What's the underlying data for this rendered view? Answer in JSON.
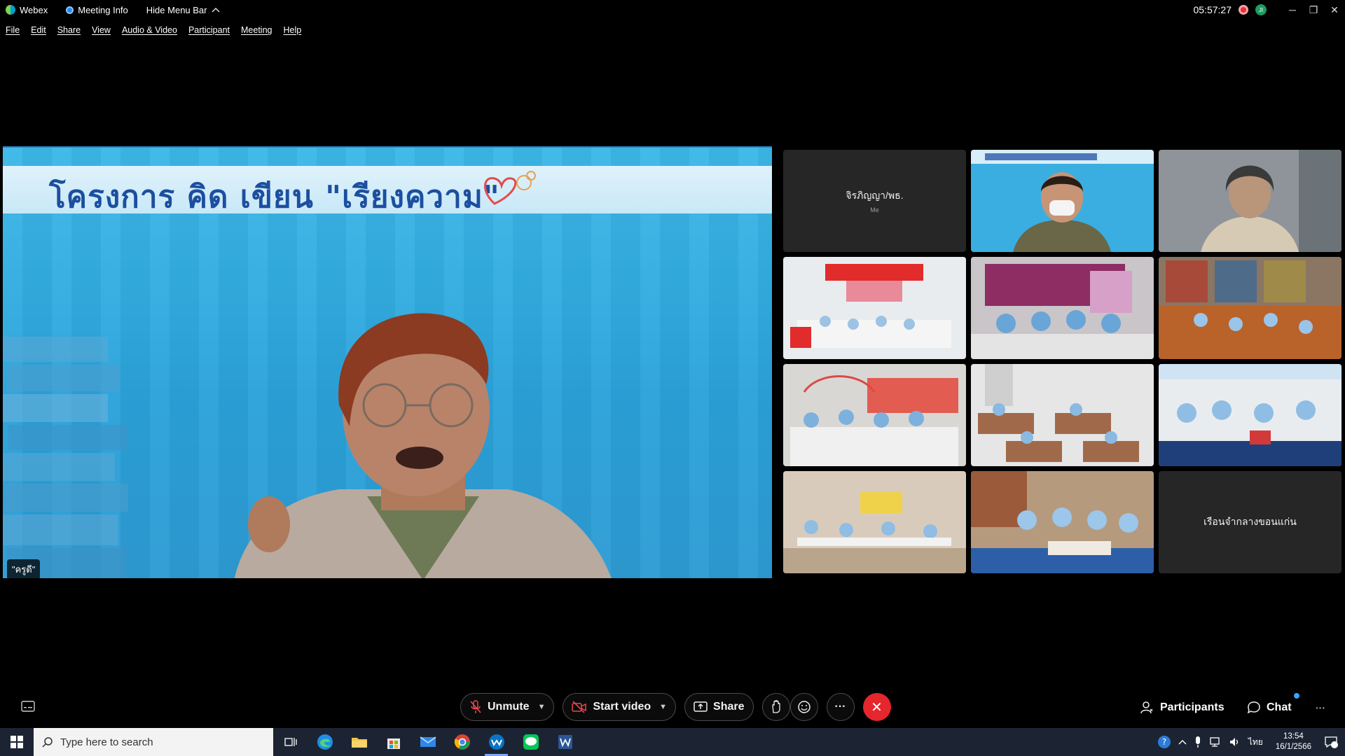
{
  "titlebar": {
    "app_name": "Webex",
    "meeting_info": "Meeting Info",
    "hide_menu_bar": "Hide Menu Bar",
    "time": "05:57:27",
    "minimize": "─",
    "restore": "❐",
    "close": "✕"
  },
  "menubar": {
    "items": [
      "File",
      "Edit",
      "Share",
      "View",
      "Audio & Video",
      "Participant",
      "Meeting",
      "Help"
    ]
  },
  "stage": {
    "banner_title": "โครงการ คิด เขียน \"เรียงความ\"",
    "speaker_name": "\"ครูดี\""
  },
  "grid": {
    "tiles": [
      {
        "type": "placeholder",
        "name": "จิรภิญญา/พธ.",
        "sub": "Me"
      },
      {
        "type": "video",
        "scene": "presenter-banner"
      },
      {
        "type": "video",
        "scene": "man-portrait"
      },
      {
        "type": "video",
        "scene": "classroom-red"
      },
      {
        "type": "video",
        "scene": "classroom-poster"
      },
      {
        "type": "video",
        "scene": "library"
      },
      {
        "type": "video",
        "scene": "classroom-white"
      },
      {
        "type": "video",
        "scene": "classroom-desks"
      },
      {
        "type": "video",
        "scene": "classroom-chairs"
      },
      {
        "type": "video",
        "scene": "hall"
      },
      {
        "type": "video",
        "scene": "library-table"
      },
      {
        "type": "placeholder",
        "name": "เรือนจำกลางขอนแก่น",
        "sub": ""
      }
    ]
  },
  "controls": {
    "unmute": "Unmute",
    "start_video": "Start video",
    "share": "Share",
    "more": "···",
    "participants": "Participants",
    "chat": "Chat",
    "overflow": "···"
  },
  "taskbar": {
    "search_placeholder": "Type here to search",
    "time": "13:54",
    "date": "16/1/2566",
    "lang": "ไทย",
    "notif_count": "1"
  },
  "colors": {
    "end_call": "#e5262c",
    "stage_blue": "#2aa2da",
    "banner_text": "#1c4fa0"
  }
}
